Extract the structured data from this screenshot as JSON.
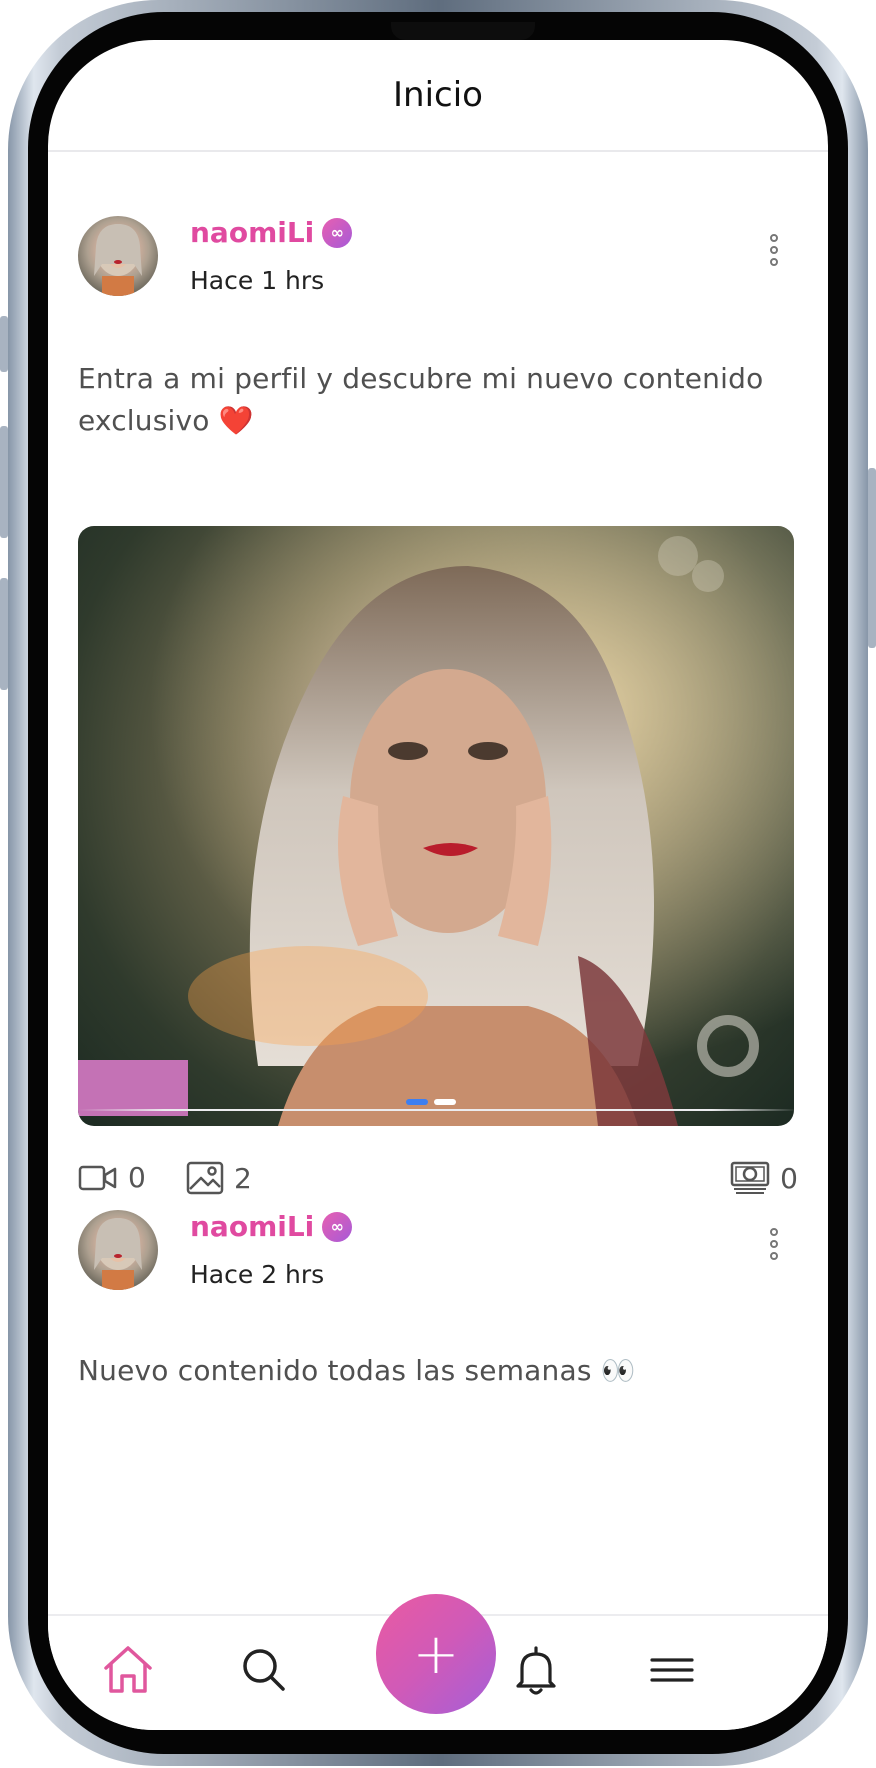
{
  "header": {
    "title": "Inicio"
  },
  "colors": {
    "accent": "#e04aa0",
    "fab_gradient_start": "#ea5ba1",
    "fab_gradient_end": "#a45fd8",
    "carousel_active": "#3d7ff1"
  },
  "posts": [
    {
      "username": "naomiLi",
      "verified_icon": "infinity-badge-icon",
      "time": "Hace 1 hrs",
      "text": "Entra a mi perfil y descubre mi nuevo contenido exclusivo ❤️",
      "media": {
        "type": "photo",
        "carousel_pages": 2,
        "carousel_active": 1
      },
      "stats": {
        "videos": "0",
        "images": "2",
        "tips": "0"
      }
    },
    {
      "username": "naomiLi",
      "verified_icon": "infinity-badge-icon",
      "time": "Hace 2 hrs",
      "text": "Nuevo contenido todas las semanas 👀"
    }
  ],
  "nav": {
    "items": [
      "home-icon",
      "search-icon",
      "add-icon",
      "bell-icon",
      "menu-icon"
    ],
    "fab_label": "+",
    "active": "home"
  }
}
